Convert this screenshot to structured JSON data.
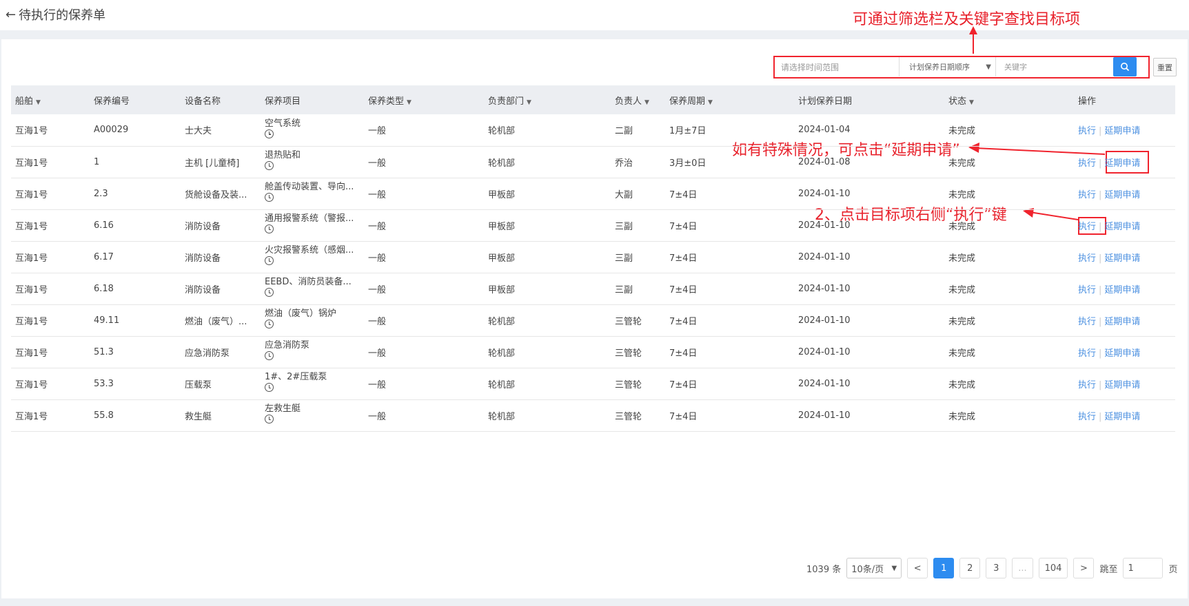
{
  "header": {
    "title": "待执行的保养单"
  },
  "filter": {
    "date_placeholder": "请选择时间范围",
    "order_select": "计划保养日期顺序",
    "keyword_placeholder": "关键字",
    "reset_label": "重置"
  },
  "annotations": {
    "filter_hint": "可通过筛选栏及关键字查找目标项",
    "delay_hint": "如有特殊情况，可点击“延期申请”",
    "execute_hint": "2、点击目标项右侧“执行”键"
  },
  "table": {
    "headers": [
      "船舶",
      "保养编号",
      "设备名称",
      "保养项目",
      "保养类型",
      "负责部门",
      "负责人",
      "保养周期",
      "计划保养日期",
      "状态",
      "操作"
    ],
    "rows": [
      {
        "ship": "互海1号",
        "code": "A00029",
        "equipment": "士大夫",
        "item": "空气系统",
        "type": "一般",
        "dept": "轮机部",
        "person": "二副",
        "cycle": "1月±7日",
        "date": "2024-01-04",
        "status": "未完成"
      },
      {
        "ship": "互海1号",
        "code": "1",
        "equipment": "主机 [儿童椅]",
        "item": "退热贴和",
        "type": "一般",
        "dept": "轮机部",
        "person": "乔治",
        "cycle": "3月±0日",
        "date": "2024-01-08",
        "status": "未完成"
      },
      {
        "ship": "互海1号",
        "code": "2.3",
        "equipment": "货舱设备及装...",
        "item": "舱盖传动装置、导向...",
        "type": "一般",
        "dept": "甲板部",
        "person": "大副",
        "cycle": "7±4日",
        "date": "2024-01-10",
        "status": "未完成"
      },
      {
        "ship": "互海1号",
        "code": "6.16",
        "equipment": "消防设备",
        "item": "通用报警系统（警报...",
        "type": "一般",
        "dept": "甲板部",
        "person": "三副",
        "cycle": "7±4日",
        "date": "2024-01-10",
        "status": "未完成"
      },
      {
        "ship": "互海1号",
        "code": "6.17",
        "equipment": "消防设备",
        "item": "火灾报警系统（感烟...",
        "type": "一般",
        "dept": "甲板部",
        "person": "三副",
        "cycle": "7±4日",
        "date": "2024-01-10",
        "status": "未完成"
      },
      {
        "ship": "互海1号",
        "code": "6.18",
        "equipment": "消防设备",
        "item": "EEBD、消防员装备...",
        "type": "一般",
        "dept": "甲板部",
        "person": "三副",
        "cycle": "7±4日",
        "date": "2024-01-10",
        "status": "未完成"
      },
      {
        "ship": "互海1号",
        "code": "49.11",
        "equipment": "燃油（废气）...",
        "item": "燃油（废气）锅炉",
        "type": "一般",
        "dept": "轮机部",
        "person": "三管轮",
        "cycle": "7±4日",
        "date": "2024-01-10",
        "status": "未完成"
      },
      {
        "ship": "互海1号",
        "code": "51.3",
        "equipment": "应急消防泵",
        "item": "应急消防泵",
        "type": "一般",
        "dept": "轮机部",
        "person": "三管轮",
        "cycle": "7±4日",
        "date": "2024-01-10",
        "status": "未完成"
      },
      {
        "ship": "互海1号",
        "code": "53.3",
        "equipment": "压载泵",
        "item": "1#、2#压载泵",
        "type": "一般",
        "dept": "轮机部",
        "person": "三管轮",
        "cycle": "7±4日",
        "date": "2024-01-10",
        "status": "未完成"
      },
      {
        "ship": "互海1号",
        "code": "55.8",
        "equipment": "救生艇",
        "item": "左救生艇",
        "type": "一般",
        "dept": "轮机部",
        "person": "三管轮",
        "cycle": "7±4日",
        "date": "2024-01-10",
        "status": "未完成"
      }
    ],
    "action_execute": "执行",
    "action_delay": "延期申请"
  },
  "pagination": {
    "total": "1039 条",
    "page_size": "10条/页",
    "prev": "<",
    "pages": [
      "1",
      "2",
      "3",
      "...",
      "104"
    ],
    "next": ">",
    "jump_label": "跳至",
    "jump_value": "1",
    "page_unit": "页"
  },
  "colors": {
    "accent": "#2d8cf0",
    "annotation": "#f0232d",
    "link": "#4a8fe0"
  }
}
